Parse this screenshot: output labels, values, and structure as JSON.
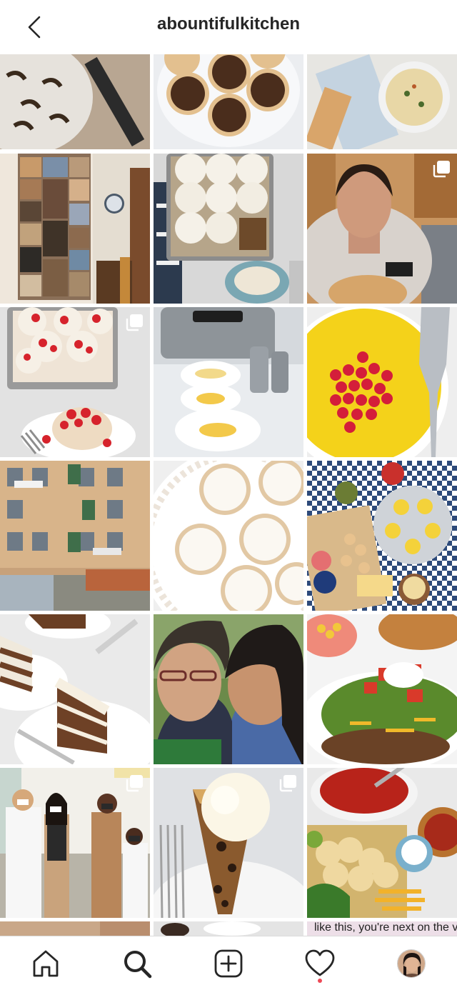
{
  "header": {
    "username": "abountifulkitchen",
    "back_icon": "chevron-left-icon"
  },
  "grid": {
    "last_row_text": "like this, you're next on the vaccine schedule"
  },
  "bottom_nav": {
    "items": [
      "home-icon",
      "search-icon",
      "new-post-icon",
      "activity-heart-icon",
      "profile-avatar"
    ],
    "active": "search-icon",
    "has_activity_notification": true
  },
  "colors": {
    "notification_dot": "#ed4956",
    "text": "#262626"
  }
}
